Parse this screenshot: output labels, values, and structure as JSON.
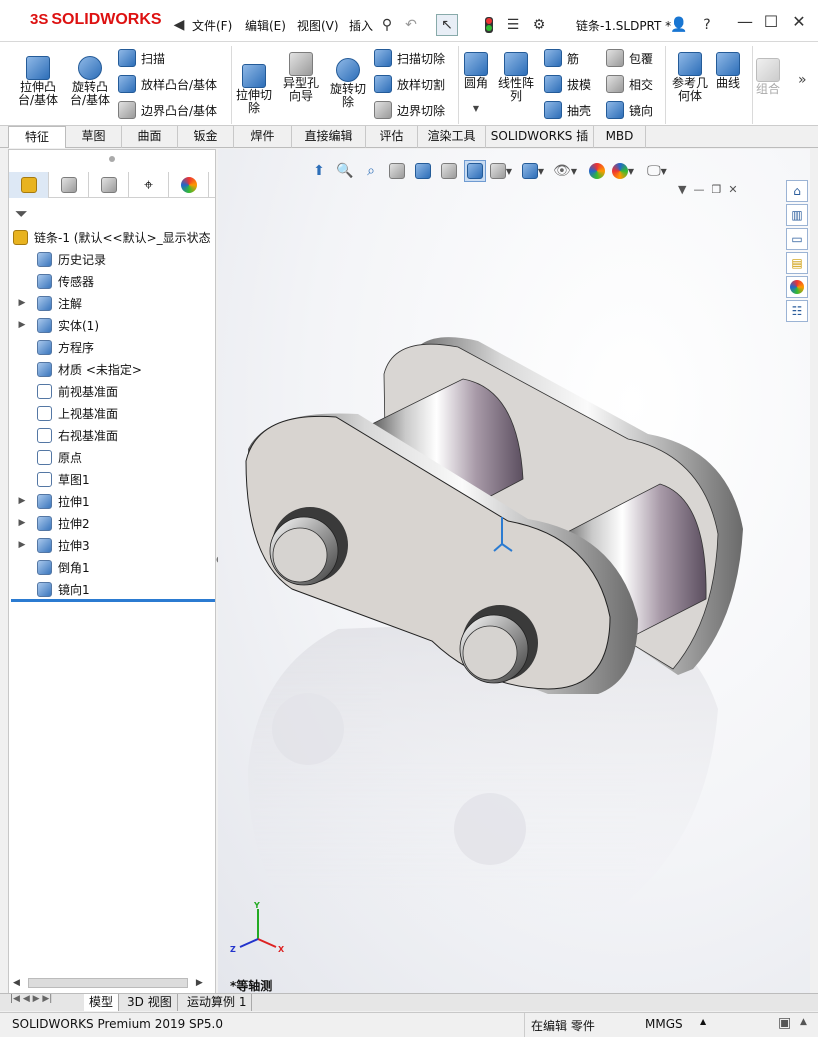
{
  "app": {
    "logo_text": "SOLIDWORKS",
    "logo_mark": "3S",
    "doc_title": "链条-1.SLDPRT *"
  },
  "menu": {
    "file": "文件(F)",
    "edit": "编辑(E)",
    "view": "视图(V)",
    "insert": "插入"
  },
  "ribbon": {
    "extrude_boss": "拉伸凸\n台/基体",
    "revolve_boss": "旋转凸\n台/基体",
    "sweep": "扫描",
    "loft_boss": "放样凸台/基体",
    "boundary_boss": "边界凸台/基体",
    "extrude_cut": "拉伸切\n除",
    "hole_wizard": "异型孔\n向导",
    "revolve_cut": "旋转切\n除",
    "swept_cut": "扫描切除",
    "lofted_cut": "放样切割",
    "boundary_cut": "边界切除",
    "fillet": "圆角",
    "linear_pattern": "线性阵\n列",
    "rib": "筋",
    "draft": "拔模",
    "shell": "抽壳",
    "wrap": "包覆",
    "intersect": "相交",
    "mirror": "镜向",
    "ref_geometry": "参考几\n何体",
    "curves": "曲线",
    "combine": "组合"
  },
  "command_tabs": [
    "特征",
    "草图",
    "曲面",
    "钣金",
    "焊件",
    "直接编辑",
    "评估",
    "渲染工具",
    "SOLIDWORKS 插件",
    "MBD"
  ],
  "tree": {
    "root": "链条-1  (默认<<默认>_显示状态",
    "items": [
      {
        "label": "历史记录",
        "icon": "history-icon",
        "expandable": false
      },
      {
        "label": "传感器",
        "icon": "sensor-icon",
        "expandable": false
      },
      {
        "label": "注解",
        "icon": "annotation-icon",
        "expandable": true
      },
      {
        "label": "实体(1)",
        "icon": "solid-body-icon",
        "expandable": true
      },
      {
        "label": "方程序",
        "icon": "equation-icon",
        "expandable": false
      },
      {
        "label": "材质 <未指定>",
        "icon": "material-icon",
        "expandable": false
      },
      {
        "label": "前视基准面",
        "icon": "plane-icon",
        "expandable": false
      },
      {
        "label": "上视基准面",
        "icon": "plane-icon",
        "expandable": false
      },
      {
        "label": "右视基准面",
        "icon": "plane-icon",
        "expandable": false
      },
      {
        "label": "原点",
        "icon": "origin-icon",
        "expandable": false
      },
      {
        "label": "草图1",
        "icon": "sketch-icon",
        "expandable": false
      },
      {
        "label": "拉伸1",
        "icon": "extrude-icon",
        "expandable": true
      },
      {
        "label": "拉伸2",
        "icon": "extrude-icon",
        "expandable": true
      },
      {
        "label": "拉伸3",
        "icon": "extrude-icon",
        "expandable": true
      },
      {
        "label": "倒角1",
        "icon": "chamfer-icon",
        "expandable": false
      },
      {
        "label": "镜向1",
        "icon": "mirror-icon",
        "expandable": false
      }
    ]
  },
  "viewport": {
    "view_name": "*等轴测",
    "axis_x": "X",
    "axis_y": "Y",
    "axis_z": "Z"
  },
  "bottom_tabs": [
    "模型",
    "3D 视图",
    "运动算例 1"
  ],
  "status": {
    "product": "SOLIDWORKS Premium 2019 SP5.0",
    "mode": "在编辑 零件",
    "units": "MMGS"
  },
  "colors": {
    "accent_blue": "#2d6eb8",
    "logo_red": "#d11",
    "selection_blue": "#2b7bd1"
  }
}
